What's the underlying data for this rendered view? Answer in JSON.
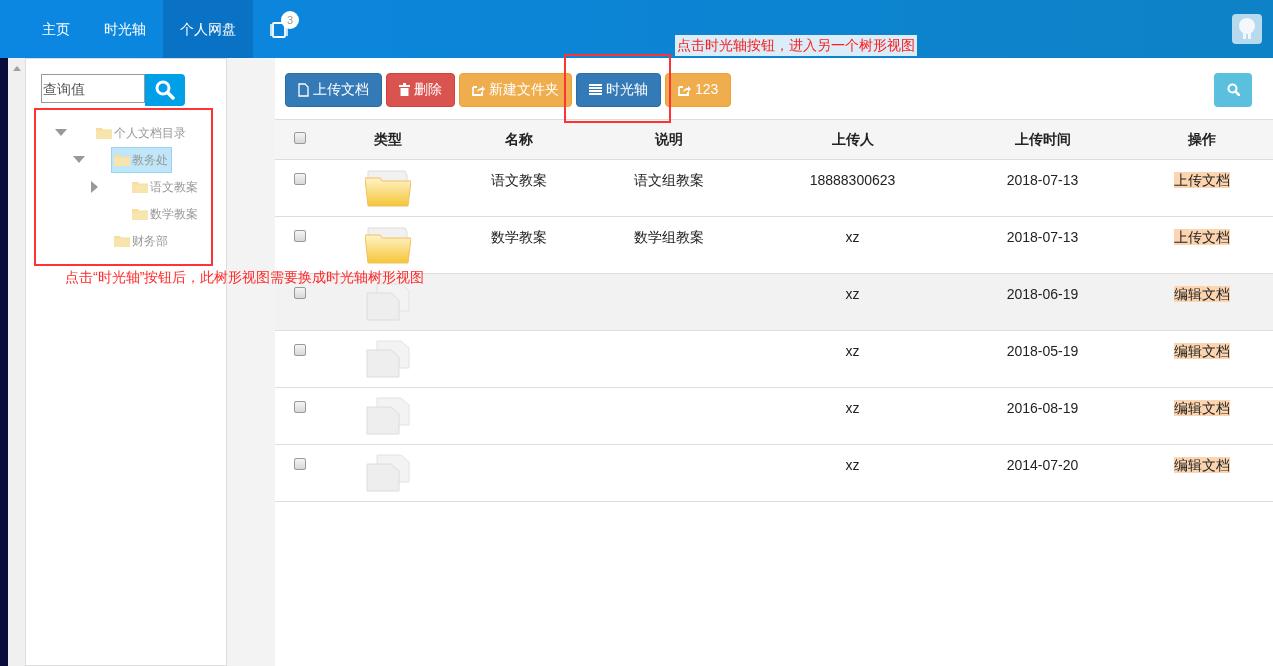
{
  "nav": {
    "items": [
      {
        "label": "主页",
        "selected": false
      },
      {
        "label": "时光轴",
        "selected": false
      },
      {
        "label": "个人网盘",
        "selected": true
      }
    ],
    "badge": "3"
  },
  "sidebar": {
    "search": {
      "placeholder": "查询值"
    },
    "tree": [
      {
        "label": "个人文档目录",
        "selected": false,
        "expanded": true,
        "children": [
          {
            "label": "教务处",
            "selected": true,
            "expanded": true,
            "children": [
              {
                "label": "语文教案",
                "selected": false,
                "expanded": false
              },
              {
                "label": "数学教案",
                "selected": false
              }
            ]
          },
          {
            "label": "财务部",
            "selected": false
          }
        ]
      }
    ]
  },
  "toolbar": {
    "buttons": [
      {
        "label": "上传文档",
        "kind": "primary"
      },
      {
        "label": "删除",
        "kind": "danger"
      },
      {
        "label": "新建文件夹",
        "kind": "warning"
      },
      {
        "label": "时光轴",
        "kind": "primary"
      },
      {
        "label": "123",
        "kind": "warning"
      }
    ]
  },
  "table": {
    "all_checked": false,
    "columns": [
      "类型",
      "名称",
      "说明",
      "上传人",
      "上传时间",
      "操作"
    ],
    "rows": [
      {
        "kind": "folder",
        "checked": false,
        "hovered": false,
        "name": "语文教案",
        "description": "语文组教案",
        "uploader": "18888300623",
        "date": "2018-07-13",
        "action": "上传文档"
      },
      {
        "kind": "folder",
        "checked": false,
        "hovered": false,
        "name": "数学教案",
        "description": "数学组教案",
        "uploader": "xz",
        "date": "2018-07-13",
        "action": "上传文档"
      },
      {
        "kind": "file",
        "checked": false,
        "hovered": true,
        "uploader": "xz",
        "date": "2018-06-19",
        "action": "编辑文档"
      },
      {
        "kind": "file",
        "checked": false,
        "hovered": false,
        "uploader": "xz",
        "date": "2018-05-19",
        "action": "编辑文档"
      },
      {
        "kind": "file",
        "checked": false,
        "hovered": false,
        "uploader": "xz",
        "date": "2016-08-19",
        "action": "编辑文档"
      },
      {
        "kind": "file",
        "checked": false,
        "hovered": false,
        "uploader": "xz",
        "date": "2014-07-20",
        "action": "编辑文档"
      }
    ]
  },
  "annotations": [
    "点击时光轴按钮，进入另一个树形视图",
    "点击“时光轴”按钮后，此树形视图需要换成时光轴树形视图"
  ]
}
